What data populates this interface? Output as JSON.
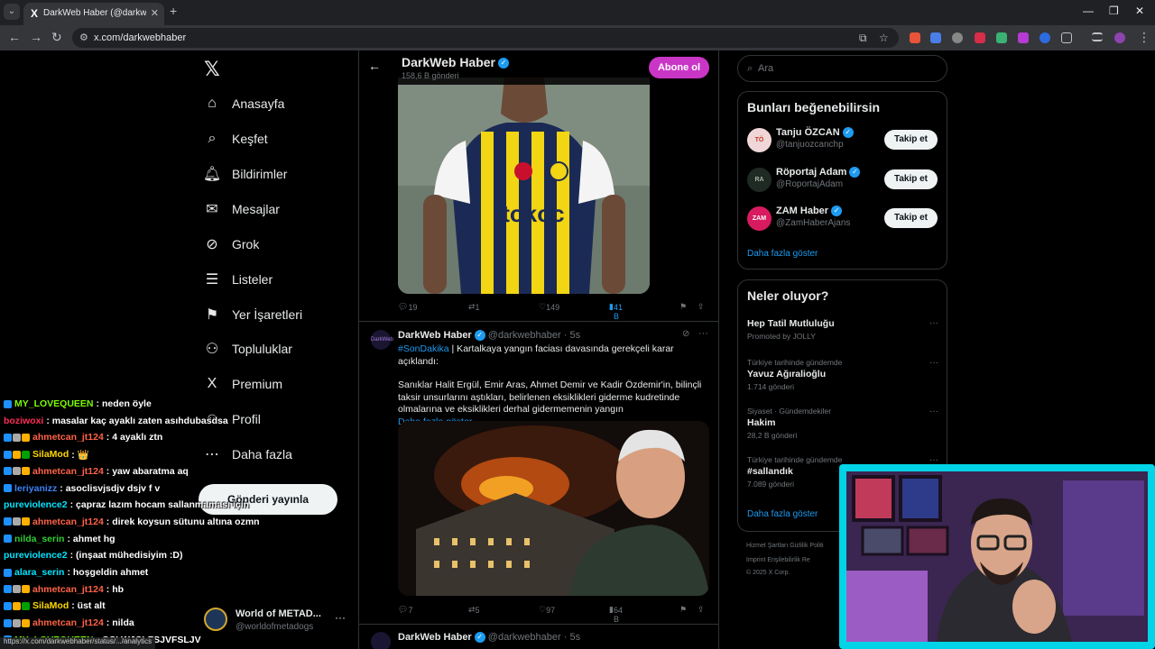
{
  "browser": {
    "tab_title": "DarkWeb Haber (@darkwebhaber) / X",
    "tab_logo": "X",
    "address": "x.com/darkwebhaber",
    "window_controls": [
      "—",
      "❐",
      "✕"
    ]
  },
  "nav": {
    "items": [
      {
        "label": "Anasayfa",
        "icon": "⌂",
        "icon_name": "home-icon"
      },
      {
        "label": "Keşfet",
        "icon": "⌕",
        "icon_name": "search-icon"
      },
      {
        "label": "Bildirimler",
        "icon": "🔔︎",
        "icon_name": "bell-icon"
      },
      {
        "label": "Mesajlar",
        "icon": "✉",
        "icon_name": "mail-icon"
      },
      {
        "label": "Grok",
        "icon": "⊘",
        "icon_name": "grok-icon"
      },
      {
        "label": "Listeler",
        "icon": "☰",
        "icon_name": "list-icon"
      },
      {
        "label": "Yer İşaretleri",
        "icon": "⚑",
        "icon_name": "bookmark-icon"
      },
      {
        "label": "Topluluklar",
        "icon": "⚇",
        "icon_name": "communities-icon"
      },
      {
        "label": "Premium",
        "icon": "X",
        "icon_name": "premium-icon"
      },
      {
        "label": "Profil",
        "icon": "☺",
        "icon_name": "profile-icon"
      },
      {
        "label": "Daha fazla",
        "icon": "⋯",
        "icon_name": "more-icon"
      }
    ],
    "post_button": "Gönderi yayınla",
    "account": {
      "name": "World of METAD...",
      "handle": "@worldofmetadogs"
    }
  },
  "profile_header": {
    "name": "DarkWeb Haber",
    "post_count": "158,6 B gönderi",
    "subscribe": "Abone ol"
  },
  "post1": {
    "stats": {
      "replies": "19",
      "reposts": "1",
      "likes": "149",
      "views": "41 B"
    }
  },
  "post2": {
    "avatar_text": "DarkWeb",
    "name": "DarkWeb Haber",
    "handle": "@darkwebhaber",
    "time": "· 5s",
    "hashtag": "#SonDakika",
    "headline": " | Kartalkaya yangın faciası davasında gerekçeli karar açıklandı:",
    "body": "Sanıklar Halit Ergül, Emir Aras, Ahmet Demir ve Kadir Özdemir'in, bilinçli taksir unsurlarını aştıkları, belirlenen eksiklikleri giderme kudretinde olmalarına ve eksiklikleri derhal gidermemenin yangın",
    "show_more": "Daha fazla göster",
    "stats": {
      "replies": "7",
      "reposts": "5",
      "likes": "97",
      "views": "64 B"
    }
  },
  "post3": {
    "name": "DarkWeb Haber",
    "handle": "@darkwebhaber",
    "time": "· 5s"
  },
  "right": {
    "search_placeholder": "Ara",
    "suggest_title": "Bunları beğenebilirsin",
    "suggestions": [
      {
        "name": "Tanju ÖZCAN",
        "handle": "@tanjuozcanchp",
        "button": "Takip et",
        "avatar": "TÖ"
      },
      {
        "name": "Röportaj Adam",
        "handle": "@RoportajAdam",
        "button": "Takip et",
        "avatar": "RA"
      },
      {
        "name": "ZAM Haber",
        "handle": "@ZamHaberAjans",
        "button": "Takip et",
        "avatar": "ZAM"
      }
    ],
    "show_more": "Daha fazla göster",
    "trends_title": "Neler oluyor?",
    "trends": [
      {
        "context": "",
        "name": "Hep Tatil Mutluluğu",
        "count": "Promoted by JOLLY"
      },
      {
        "context": "Türkiye tarihinde gündemde",
        "name": "Yavuz Ağıralioğlu",
        "count": "1.714 gönderi"
      },
      {
        "context": "Siyaset · Gündemdekiler",
        "name": "Hakim",
        "count": "28,2 B gönderi"
      },
      {
        "context": "Türkiye tarihinde gündemde",
        "name": "#sallandık",
        "count": "7.089 gönderi"
      }
    ],
    "trends_show_more": "Daha fazla göster",
    "footer_line1": "Hizmet Şartları    Gizlilik Politi",
    "footer_line2": "Imprint    Erişilebilirlik    Re",
    "footer_line3": "© 2025 X Corp."
  },
  "chat": [
    {
      "user": "MY_LOVEQUEEN",
      "color": "#7cfc00",
      "badges": [
        "#1e90ff"
      ],
      "msg": ": neden öyle"
    },
    {
      "user": "boziwoxi",
      "color": "#ff2d55",
      "badges": [],
      "msg": ": masalar kaç ayaklı zaten asıhdubasdsa"
    },
    {
      "user": "ahmetcan_jt124",
      "color": "#ff6347",
      "badges": [
        "#1e90ff",
        "#aaaaaa",
        "#ffb000"
      ],
      "msg": ": 4 ayaklı ztn"
    },
    {
      "user": "SilaMod",
      "color": "#ffd700",
      "badges": [
        "#1e90ff",
        "#ffb000",
        "#00a000"
      ],
      "msg": ": 👑"
    },
    {
      "user": "ahmetcan_jt124",
      "color": "#ff6347",
      "badges": [
        "#1e90ff",
        "#aaaaaa",
        "#ffb000"
      ],
      "msg": ": yaw abaratma aq"
    },
    {
      "user": "leriyanizz",
      "color": "#3b82f6",
      "badges": [
        "#1e90ff"
      ],
      "msg": ": asoclisvjsdjv dsjv f v"
    },
    {
      "user": "pureviolence2",
      "color": "#00e5ff",
      "badges": [],
      "msg": ": çapraz lazım hocam sallanmaması için"
    },
    {
      "user": "ahmetcan_jt124",
      "color": "#ff6347",
      "badges": [
        "#1e90ff",
        "#aaaaaa",
        "#ffb000"
      ],
      "msg": ": direk koysun sütunu altına ozmn"
    },
    {
      "user": "nilda_serin",
      "color": "#32cd32",
      "badges": [
        "#1e90ff"
      ],
      "msg": ": ahmet hg"
    },
    {
      "user": "pureviolence2",
      "color": "#00e5ff",
      "badges": [],
      "msg": ": (inşaat mühedisiyim :D)"
    },
    {
      "user": "alara_serin",
      "color": "#00e5ff",
      "badges": [
        "#1e90ff"
      ],
      "msg": ": hoşgeldin ahmet"
    },
    {
      "user": "ahmetcan_jt124",
      "color": "#ff6347",
      "badges": [
        "#1e90ff",
        "#aaaaaa",
        "#ffb000"
      ],
      "msg": ": hb"
    },
    {
      "user": "SilaMod",
      "color": "#ffd700",
      "badges": [
        "#1e90ff",
        "#ffb000",
        "#00a000"
      ],
      "msg": ": üst alt"
    },
    {
      "user": "ahmetcan_jt124",
      "color": "#ff6347",
      "badges": [
        "#1e90ff",
        "#aaaaaa",
        "#ffb000"
      ],
      "msg": ": nilda"
    },
    {
      "user": "MY_LOVEQUEEN",
      "color": "#7cfc00",
      "badges": [
        "#1e90ff"
      ],
      "msg": ": OSLWJCLFSJVFSLJV"
    }
  ],
  "status_url": "https://x.com/darkwebhaber/status/.../analytics"
}
